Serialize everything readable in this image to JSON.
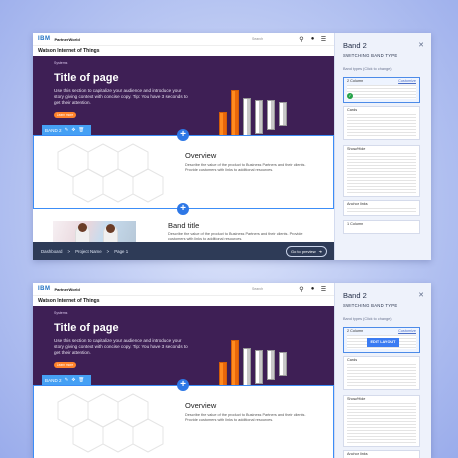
{
  "brand": {
    "logo": "IBM",
    "product": "PartnerWorld"
  },
  "search": {
    "placeholder": "Search"
  },
  "site_title": "Watson Internet of Things",
  "hero": {
    "breadcrumb": "Systems",
    "title": "Title of page",
    "description": "Use this section to capitalize your audience and introduce your story giving context with concise copy. Tip: You have 3 seconds to get their attention.",
    "button": "Learn more",
    "follow": "Follow IBM PartnerWorld"
  },
  "band_toolbar": {
    "label": "BAND 2"
  },
  "overview": {
    "title": "Overview",
    "description": "Describe the value of the product to Business Partners and their clients. Provide customers with links to additional resources."
  },
  "band": {
    "title": "Band title",
    "description": "Describe the value of the product to Business Partners and their clients. Provide customers with links to additional resources."
  },
  "footer": {
    "crumbs": [
      "Dashboard",
      ">",
      "Project Name",
      ">",
      "Page 1"
    ],
    "button": "Go to preview"
  },
  "panel": {
    "title": "Band 2",
    "subtitle": "SWITCHING BAND TYPE",
    "hint": "Band types (Click to change)",
    "edit_button": "EDIT LAYOUT",
    "cards": [
      {
        "label": "2 Column",
        "action": "Customize"
      },
      {
        "label": "Cards"
      },
      {
        "label": "Show/Hide"
      },
      {
        "label": "Anchor links"
      },
      {
        "label": "1 Column"
      }
    ]
  }
}
